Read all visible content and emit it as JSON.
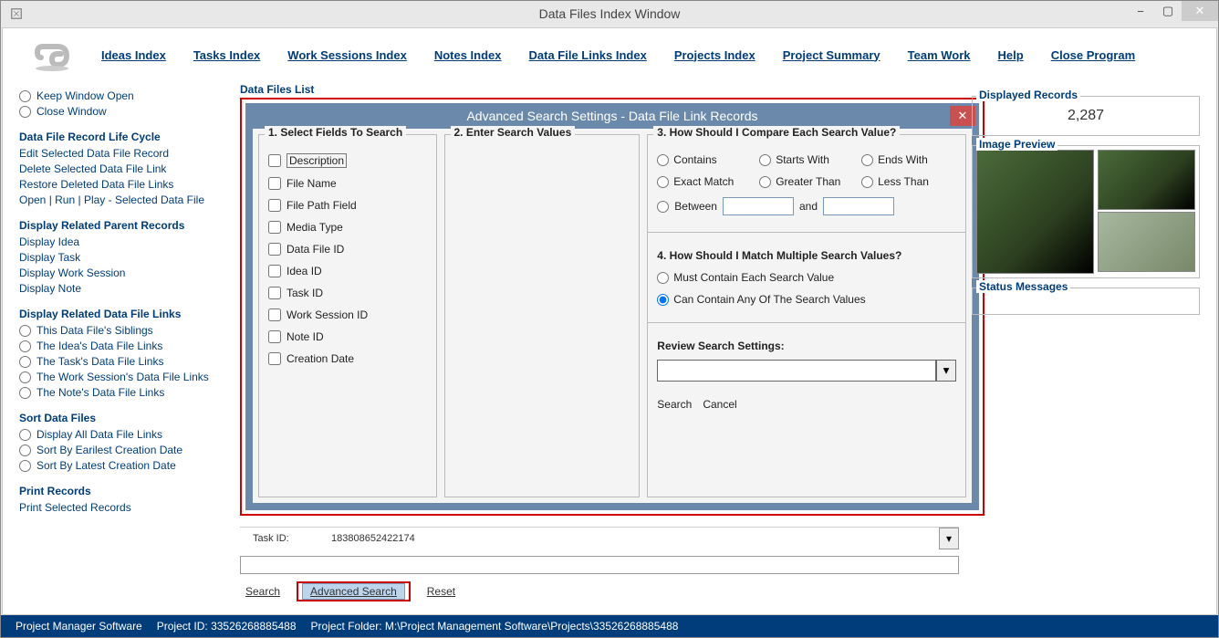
{
  "window": {
    "title": "Data Files Index Window"
  },
  "menu": {
    "ideas": "Ideas Index",
    "tasks": "Tasks Index",
    "work_sessions": "Work Sessions Index",
    "notes": "Notes Index",
    "data_file_links": "Data File Links Index",
    "projects": "Projects Index",
    "project_summary": "Project Summary",
    "team_work": "Team Work",
    "help": "Help",
    "close": "Close Program"
  },
  "sidebar": {
    "keep_open": "Keep Window Open",
    "close_window": "Close Window",
    "lifecycle_hdr": "Data File Record Life Cycle",
    "lifecycle": {
      "edit": "Edit Selected Data File Record",
      "delete": "Delete Selected Data File Link",
      "restore": "Restore Deleted Data File Links",
      "open": "Open | Run | Play - Selected Data File"
    },
    "parent_hdr": "Display Related Parent Records",
    "parent": {
      "idea": "Display Idea",
      "task": "Display Task",
      "ws": "Display Work Session",
      "note": "Display Note"
    },
    "links_hdr": "Display Related Data File Links",
    "links": {
      "siblings": "This Data File's Siblings",
      "idea": "The Idea's Data File Links",
      "task": "The Task's Data File Links",
      "ws": "The Work Session's Data File Links",
      "note": "The Note's Data File Links"
    },
    "sort_hdr": "Sort Data Files",
    "sort": {
      "all": "Display All Data File Links",
      "earliest": "Sort By Earilest Creation Date",
      "latest": "Sort By Latest Creation Date"
    },
    "print_hdr": "Print Records",
    "print": "Print Selected Records"
  },
  "center": {
    "list_hdr": "Data Files List",
    "task_label": "Task ID:",
    "task_value": "183808652422174",
    "search": "Search",
    "adv_search": "Advanced Search",
    "reset": "Reset"
  },
  "dialog": {
    "title": "Advanced Search Settings - Data File Link Records",
    "p1_title": "1. Select Fields To Search",
    "fields": {
      "desc": "Description",
      "file_name": "File Name",
      "file_path": "File Path Field",
      "media": "Media Type",
      "df_id": "Data File ID",
      "idea_id": "Idea ID",
      "task_id": "Task ID",
      "ws_id": "Work Session ID",
      "note_id": "Note ID",
      "creation": "Creation Date"
    },
    "p2_title": "2. Enter Search Values",
    "p3_title": "3. How Should I Compare Each Search Value?",
    "compare": {
      "contains": "Contains",
      "starts": "Starts With",
      "ends": "Ends With",
      "exact": "Exact Match",
      "gt": "Greater Than",
      "lt": "Less Than",
      "between": "Between",
      "and": "and"
    },
    "p4_title": "4. How Should I Match Multiple Search Values?",
    "match": {
      "must": "Must Contain Each Search Value",
      "any": "Can Contain Any Of The Search Values"
    },
    "review": "Review Search Settings:",
    "search_btn": "Search",
    "cancel_btn": "Cancel"
  },
  "right": {
    "displayed_hdr": "Displayed Records",
    "count": "2,287",
    "preview_hdr": "Image Preview",
    "status_hdr": "Status Messages"
  },
  "status": {
    "app": "Project Manager Software",
    "pid": "Project ID:  33526268885488",
    "folder": "Project Folder: M:\\Project Management Software\\Projects\\33526268885488"
  }
}
